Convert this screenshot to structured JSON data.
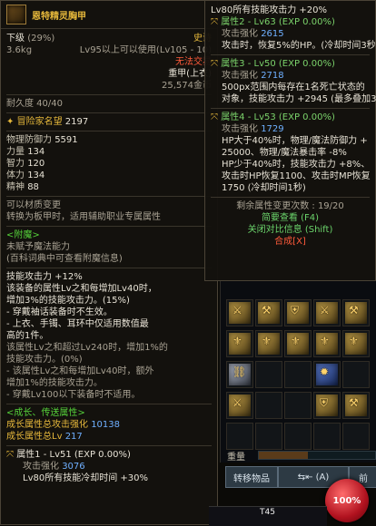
{
  "left_tooltip": {
    "item_name": "恩特精灵胸甲",
    "grade_label": "下级",
    "grade_percent": "(29%)",
    "rarity": "史诗",
    "weight": "3.6kg",
    "level_req": "Lv95以上可以使用(Lv105 - 10)",
    "trade_status": "无法交易",
    "armor_type": "重甲(上衣)",
    "price": "25,574金币",
    "durability": "耐久度 40/40",
    "reputation": "冒险家名望",
    "reputation_value": "2197",
    "stats": [
      {
        "label": "物理防御力",
        "value": "5591"
      },
      {
        "label": "力量",
        "value": "134"
      },
      {
        "label": "智力",
        "value": "120"
      },
      {
        "label": "体力",
        "value": "134"
      },
      {
        "label": "精神",
        "value": "88"
      }
    ],
    "material_transfer": "可以材质变更",
    "transfer_desc": "转换为板甲时，适用辅助职业专属属性",
    "enchant_header": "<附魔>",
    "enchant_none": "未赋予魔法能力",
    "enchant_note": "(百科词典中可查看附魔信息)",
    "skill_attack": "技能攻击力 +12%",
    "effect_lines": [
      "该装备的属性Lv之和每增加Lv40时，",
      "增加3%的技能攻击力。(15%)",
      "- 穿戴袖话装备时不生效。",
      "- 上衣、手镯、耳环中仅适用数值最",
      "高的1件。",
      "",
      "该属性Lv之和超过Lv240时，增加1%的",
      "技能攻击力。(0%)",
      "- 该属性Lv之和每增加Lv40时，额外",
      "增加1%的技能攻击力。",
      "- 穿戴Lv100以下装备时不适用。"
    ],
    "growth_header": "<成长、传送属性>",
    "growth_attack_label": "成长属性总攻击强化",
    "growth_attack_value": "10138",
    "growth_total_label": "成长属性总Lv",
    "growth_total_value": "217",
    "attr1_title": "属性1 - Lv51 (EXP 0.00%)",
    "attr1_attack_label": "攻击强化",
    "attr1_attack_value": "3076",
    "attr1_cd": "Lv80所有技能冷却时间 +30%"
  },
  "right_tooltip": {
    "line_top": "Lv80所有技能攻击力 +20%",
    "attr2_title": "属性2 - Lv63 (EXP 0.00%)",
    "attr2_attack_label": "攻击强化",
    "attr2_attack_value": "2615",
    "attr2_desc": "攻击时，恢复5%的HP。(冷却时间3秒)",
    "attr3_title": "属性3 - Lv50 (EXP 0.00%)",
    "attr3_attack_label": "攻击强化",
    "attr3_attack_value": "2718",
    "attr3_desc1": "500px范围内每存在1名死亡状态的",
    "attr3_desc2": "对象，技能攻击力 +2945 (最多叠加3次)",
    "attr4_title": "属性4 - Lv53 (EXP 0.00%)",
    "attr4_attack_label": "攻击强化",
    "attr4_attack_value": "1729",
    "attr4_lines": [
      "HP大于40%时，物理/魔法防御力 +",
      "25000、物理/魔法暴击率 -8%",
      "HP少于40%时，技能攻击力 +8%、",
      "攻击时HP恢复1100、攻击时MP恢复",
      "1750 (冷却时间1秒)"
    ],
    "remaining_label": "剩余属性变更次数 : 19/20",
    "option_simple": "简要查看 (F4)",
    "option_compare": "关闭对比信息 (Shift)",
    "combine": "合成[X]"
  },
  "inventory": {
    "weight_label": "重量",
    "transfer_label": "转移物品",
    "sort_label": "⇤ (A)",
    "close_label": "前",
    "hp_percent": "100%",
    "fps_badge": "T45"
  },
  "colors": {
    "gold": "#e6b83b",
    "green": "#55d13a",
    "blue": "#6fb0ff",
    "red": "#ff5a3a",
    "hp": "#b1121f"
  }
}
